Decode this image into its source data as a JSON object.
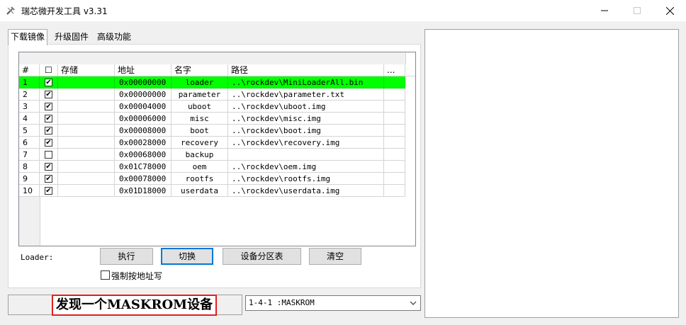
{
  "window": {
    "title": "瑞芯微开发工具 v3.31",
    "icons": {
      "app": "tools-icon",
      "minimize": "minimize-icon",
      "maximize": "maximize-icon",
      "close": "close-icon"
    }
  },
  "tabs": [
    {
      "label": "下载镜像",
      "active": true
    },
    {
      "label": "升级固件",
      "active": false
    },
    {
      "label": "高级功能",
      "active": false
    }
  ],
  "table": {
    "headers": {
      "num": "#",
      "check": "☐",
      "storage": "存储",
      "address": "地址",
      "name": "名字",
      "path": "路径",
      "more": "..."
    },
    "highlight_color": "#00ff00",
    "rows": [
      {
        "num": "1",
        "checked": true,
        "storage": "",
        "address": "0x00000000",
        "name": "loader",
        "path": "..\\rockdev\\MiniLoaderAll.bin"
      },
      {
        "num": "2",
        "checked": true,
        "storage": "",
        "address": "0x00000000",
        "name": "parameter",
        "path": "..\\rockdev\\parameter.txt"
      },
      {
        "num": "3",
        "checked": true,
        "storage": "",
        "address": "0x00004000",
        "name": "uboot",
        "path": "..\\rockdev\\uboot.img"
      },
      {
        "num": "4",
        "checked": true,
        "storage": "",
        "address": "0x00006000",
        "name": "misc",
        "path": "..\\rockdev\\misc.img"
      },
      {
        "num": "5",
        "checked": true,
        "storage": "",
        "address": "0x00008000",
        "name": "boot",
        "path": "..\\rockdev\\boot.img"
      },
      {
        "num": "6",
        "checked": true,
        "storage": "",
        "address": "0x00028000",
        "name": "recovery",
        "path": "..\\rockdev\\recovery.img"
      },
      {
        "num": "7",
        "checked": false,
        "storage": "",
        "address": "0x00068000",
        "name": "backup",
        "path": ""
      },
      {
        "num": "8",
        "checked": true,
        "storage": "",
        "address": "0x01C78000",
        "name": "oem",
        "path": "..\\rockdev\\oem.img"
      },
      {
        "num": "9",
        "checked": true,
        "storage": "",
        "address": "0x00078000",
        "name": "rootfs",
        "path": "..\\rockdev\\rootfs.img"
      },
      {
        "num": "10",
        "checked": true,
        "storage": "",
        "address": "0x01D18000",
        "name": "userdata",
        "path": "..\\rockdev\\userdata.img"
      }
    ]
  },
  "loader_label": "Loader:",
  "buttons": {
    "execute": "执行",
    "switch": "切换",
    "partition_table": "设备分区表",
    "clear": "清空"
  },
  "force_address": {
    "label": "强制按地址写",
    "checked": false
  },
  "status": {
    "message": "发现一个MASKROM设备",
    "border_color": "#e02020"
  },
  "device_select": {
    "value": "1-4-1 :MASKROM",
    "icon": "chevron-down-icon"
  }
}
